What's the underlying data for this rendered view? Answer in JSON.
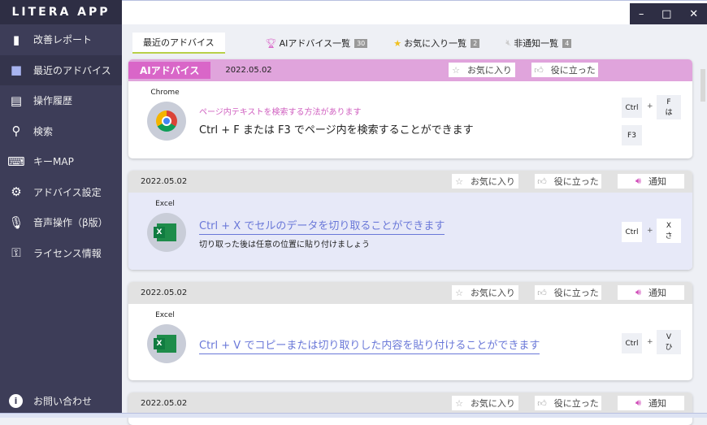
{
  "app": {
    "title": "LITERA APP"
  },
  "sidebar": {
    "items": [
      {
        "label": "改善レポート",
        "icon": "bar-chart-icon"
      },
      {
        "label": "最近のアドバイス",
        "icon": "chat-icon",
        "active": true
      },
      {
        "label": "操作履歴",
        "icon": "clipboard-icon"
      },
      {
        "label": "検索",
        "icon": "search-icon"
      },
      {
        "label": "キーMAP",
        "icon": "keyboard-icon"
      },
      {
        "label": "アドバイス設定",
        "icon": "gear-icon"
      },
      {
        "label": "音声操作（β版）",
        "icon": "microphone-icon"
      },
      {
        "label": "ライセンス情報",
        "icon": "key-icon"
      }
    ],
    "help": "お問い合わせ"
  },
  "window": {
    "minimize": "–",
    "maximize": "□",
    "close": "✕"
  },
  "tabs": [
    {
      "label": "最近のアドバイス",
      "active": true
    },
    {
      "label": "AIアドバイス一覧",
      "badge": "30",
      "icon": "trophy-icon"
    },
    {
      "label": "お気に入り一覧",
      "badge": "2",
      "icon": "star-icon"
    },
    {
      "label": "非通知一覧",
      "badge": "4",
      "icon": "mute-icon"
    }
  ],
  "actions": {
    "favorite": "お気に入り",
    "helpful": "役に立った",
    "notify": "通知"
  },
  "cards": [
    {
      "ai_label": "AIアドバイス",
      "date": "2022.05.02",
      "app": "Chrome",
      "subtitle": "ページ内テキストを検索する方法があります",
      "text": "Ctrl + F または F3 でページ内を検索することができます",
      "keys": {
        "k1": "Ctrl",
        "plus": "+",
        "k2": "F",
        "k2kana": "は",
        "k3": "F3"
      }
    },
    {
      "date": "2022.05.02",
      "app": "Excel",
      "text": "Ctrl + X でセルのデータを切り取ることができます",
      "note": "切り取った後は任意の位置に貼り付けましょう",
      "keys": {
        "k1": "Ctrl",
        "plus": "+",
        "k2": "X",
        "k2kana": "さ"
      }
    },
    {
      "date": "2022.05.02",
      "app": "Excel",
      "text": "Ctrl + V でコピーまたは切り取りした内容を貼り付けることができます",
      "keys": {
        "k1": "Ctrl",
        "plus": "+",
        "k2": "V",
        "k2kana": "ひ"
      }
    },
    {
      "date": "2022.05.02"
    }
  ],
  "colors": {
    "sidebar": "#3d3d58",
    "ai_header": "#e0a4dc",
    "ai_label": "#d966c8",
    "link": "#6a78d8"
  }
}
